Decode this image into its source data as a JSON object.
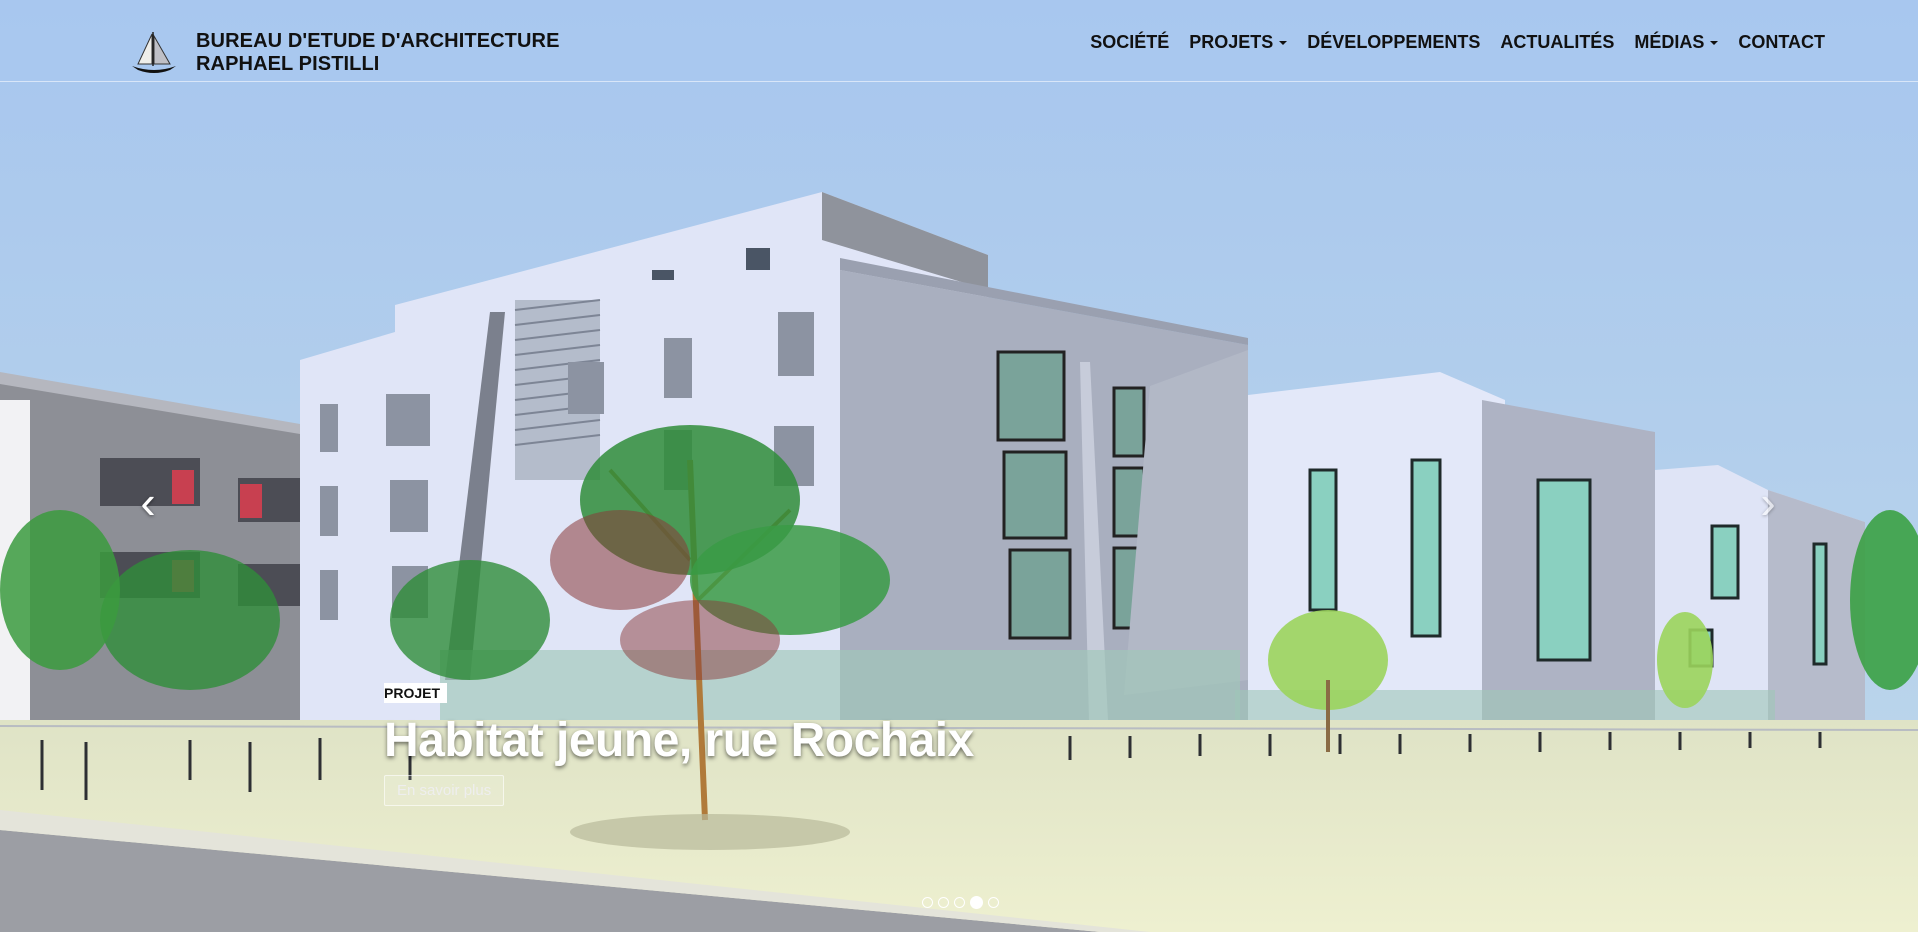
{
  "brand": {
    "line1": "BUREAU D'ETUDE D'ARCHITECTURE",
    "line2": "RAPHAEL PISTILLI",
    "logo_icon": "sailboat-logo-icon"
  },
  "nav": {
    "items": [
      {
        "label": "SOCIÉTÉ",
        "dropdown": false
      },
      {
        "label": "PROJETS",
        "dropdown": true
      },
      {
        "label": "DÉVELOPPEMENTS",
        "dropdown": false
      },
      {
        "label": "ACTUALITÉS",
        "dropdown": false
      },
      {
        "label": "MÉDIAS",
        "dropdown": true
      },
      {
        "label": "CONTACT",
        "dropdown": false
      }
    ]
  },
  "carousel": {
    "prev_icon": "chevron-left-icon",
    "next_icon": "chevron-right-icon",
    "prev_glyph": "‹",
    "next_glyph": "›",
    "slide_count": 5,
    "active_slide": 4,
    "caption": {
      "tag": "PROJET",
      "title": "Habitat jeune, rue Rochaix",
      "button": "En savoir plus"
    }
  },
  "colors": {
    "sky": "#a9c8ee",
    "header_bg": "#aac8f0",
    "facade": "#dfe5f7",
    "ground": "#e6e6c8"
  }
}
